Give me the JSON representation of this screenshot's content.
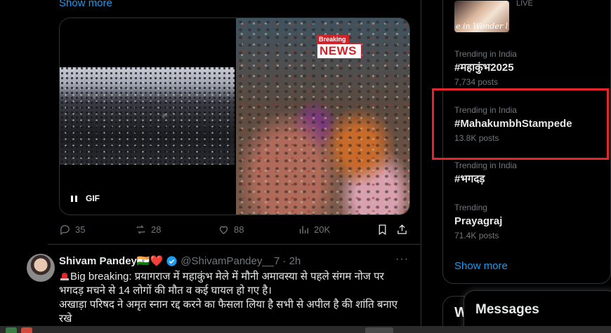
{
  "feed": {
    "show_more_top": "Show more",
    "media": {
      "gif_label": "GIF",
      "breaking_label": "Breaking",
      "news_label": "NEWS"
    },
    "actions": {
      "replies": "35",
      "reposts": "28",
      "likes": "88",
      "views": "20K"
    }
  },
  "tweet": {
    "name": "Shivam Pandey🇮🇳❤️",
    "handle": "@ShivamPandey__7",
    "time": "· 2h",
    "more": "···",
    "line1": "Big breaking: प्रयागराज में महाकुंभ मेले में मौनी अमावस्या से पहले संगम नोज पर भगदड़ मचने से 14 लोगों की मौत व कई घायल हो गए है।",
    "line2": "अखाड़ा परिषद ने अमृत स्नान रद्द करने का फैसला लिया है सभी से अपील है की शांति बनाए रखे"
  },
  "sidebar": {
    "live_label": "LIVE",
    "live_card_text": "e in Wonder l",
    "trends": [
      {
        "context": "Trending in India",
        "tag": "#महाकुंभ2025",
        "posts": "7,734 posts"
      },
      {
        "context": "Trending in India",
        "tag": "#MahakumbhStampede",
        "posts": "13.8K posts"
      },
      {
        "context": "Trending in India",
        "tag": "#भगदड़",
        "posts": ""
      },
      {
        "context": "Trending",
        "tag": "Prayagraj",
        "posts": "71.4K posts"
      }
    ],
    "show_more": "Show more",
    "who_to_follow_partial": "W",
    "messages_label": "Messages"
  },
  "colors": {
    "accent": "#1d9bf0",
    "highlight": "#e4252c",
    "muted": "#71767b",
    "background": "#000000"
  },
  "icons": [
    "reply-icon",
    "repost-icon",
    "like-icon",
    "views-icon",
    "bookmark-icon",
    "share-icon",
    "verified-icon",
    "siren-icon",
    "pause-icon"
  ]
}
